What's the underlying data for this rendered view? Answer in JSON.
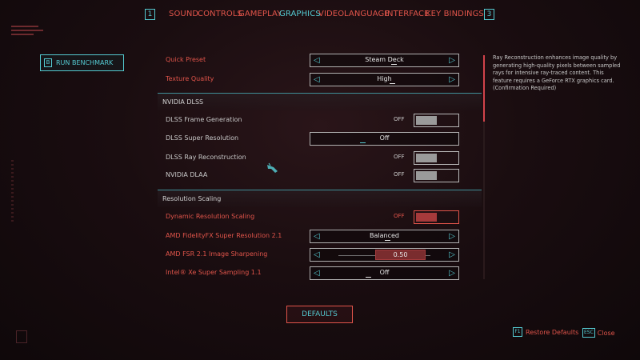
{
  "nav": {
    "left_key": "1",
    "right_key": "3",
    "tabs": [
      {
        "label": "SOUND",
        "active": false
      },
      {
        "label": "CONTROLS",
        "active": false
      },
      {
        "label": "GAMEPLAY",
        "active": false
      },
      {
        "label": "GRAPHICS",
        "active": true
      },
      {
        "label": "VIDEO",
        "active": false
      },
      {
        "label": "LANGUAGE",
        "active": false
      },
      {
        "label": "INTERFACE",
        "active": false
      },
      {
        "label": "KEY BINDINGS",
        "active": false
      }
    ]
  },
  "benchmark": {
    "key": "B",
    "label": "RUN BENCHMARK"
  },
  "settings": {
    "quick_preset": {
      "label": "Quick Preset",
      "value": "Steam Deck"
    },
    "texture_quality": {
      "label": "Texture Quality",
      "value": "High"
    },
    "nvidia_dlss_header": "NVIDIA DLSS",
    "dlss_frame_gen": {
      "label": "DLSS Frame Generation",
      "value": "OFF"
    },
    "dlss_super_res": {
      "label": "DLSS Super Resolution",
      "value": "Off"
    },
    "dlss_ray_recon": {
      "label": "DLSS Ray Reconstruction",
      "value": "OFF"
    },
    "nvidia_dlaa": {
      "label": "NVIDIA DLAA",
      "value": "OFF"
    },
    "resolution_scaling_header": "Resolution Scaling",
    "dynamic_res": {
      "label": "Dynamic Resolution Scaling",
      "value": "OFF"
    },
    "amd_fsr": {
      "label": "AMD FidelityFX Super Resolution 2.1",
      "value": "Balanced"
    },
    "amd_sharpen": {
      "label": "AMD FSR 2.1 Image Sharpening",
      "value": "0.50",
      "fraction": 0.5
    },
    "intel_xess": {
      "label": "Intel® Xe Super Sampling 1.1",
      "value": "Off"
    }
  },
  "description": "Ray Reconstruction enhances image quality by generating high-quality pixels between sampled rays for intensive ray-traced content. This feature requires a GeForce RTX graphics card. (Confirmation Required)",
  "defaults_label": "DEFAULTS",
  "footer": {
    "restore_key": "F1",
    "restore_label": "Restore Defaults",
    "close_key": "ESC",
    "close_label": "Close"
  },
  "colors": {
    "accent_red": "#e0544a",
    "accent_cyan": "#54c9d0",
    "background": "#1a0d10"
  }
}
